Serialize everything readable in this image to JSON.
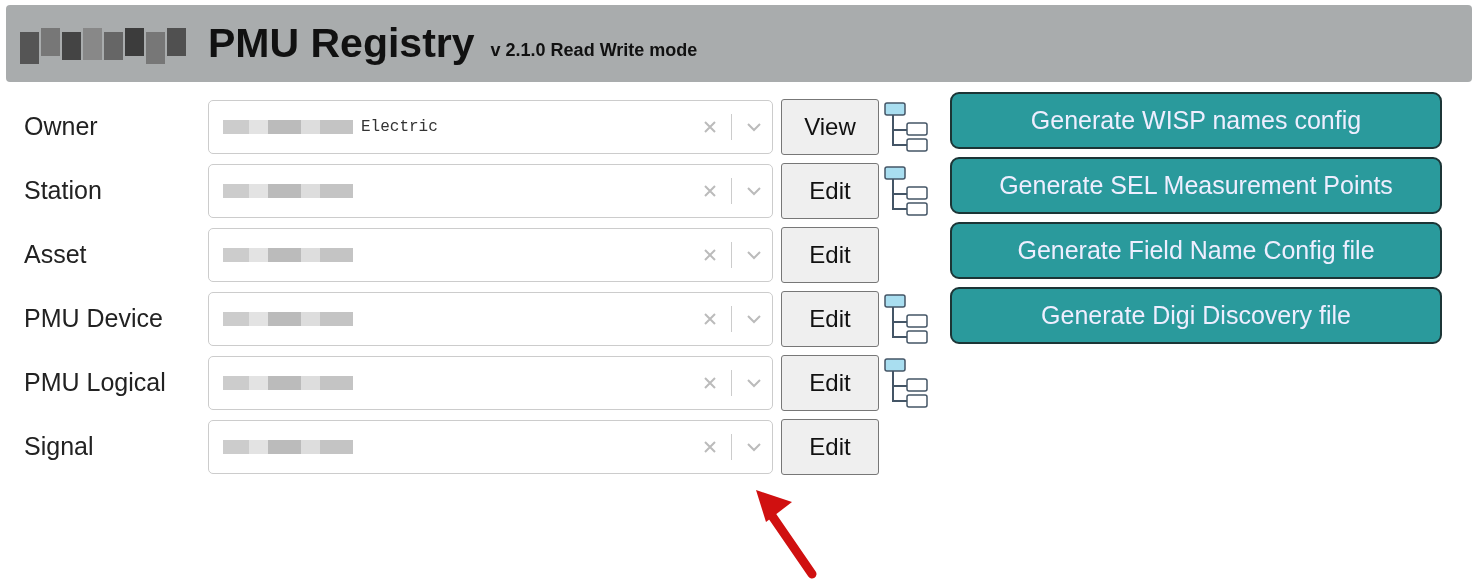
{
  "header": {
    "logo": {
      "kind": "redacted"
    },
    "title": "PMU Registry",
    "subtitle": "v 2.1.0 Read Write mode"
  },
  "rows": [
    {
      "label": "Owner",
      "value": "Electric",
      "redacted": true,
      "button": "View",
      "tree_icon": true
    },
    {
      "label": "Station",
      "redacted": true,
      "button": "Edit",
      "tree_icon": true
    },
    {
      "label": "Asset",
      "redacted": true,
      "button": "Edit",
      "tree_icon": false
    },
    {
      "label": "PMU Device",
      "redacted": true,
      "button": "Edit",
      "tree_icon": true
    },
    {
      "label": "PMU Logical",
      "redacted": true,
      "button": "Edit",
      "tree_icon": true
    },
    {
      "label": "Signal",
      "redacted": true,
      "button": "Edit",
      "tree_icon": false
    }
  ],
  "actions": [
    "Generate WISP names config",
    "Generate SEL Measurement Points",
    "Generate Field Name Config file",
    "Generate Digi Discovery file"
  ],
  "annotation": {
    "kind": "arrow"
  }
}
